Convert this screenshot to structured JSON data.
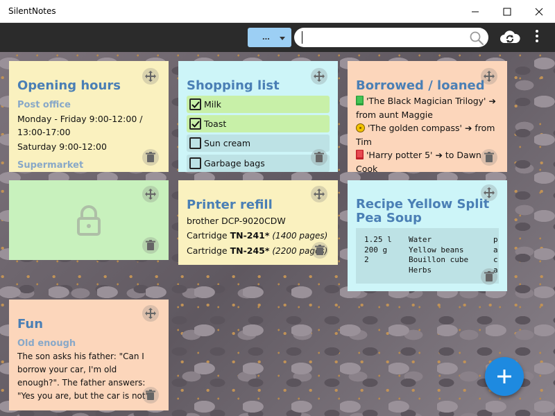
{
  "window": {
    "title": "SilentNotes"
  },
  "toolbar": {
    "filter_label": "...",
    "search_value": ""
  },
  "notes": {
    "opening_hours": {
      "title": "Opening hours",
      "sub1": "Post office",
      "line1": "Monday - Friday 9:00-12:00 / 13:00-17:00",
      "line2": "Saturday 9:00-12:00",
      "sub2": "Supermarket"
    },
    "shopping": {
      "title": "Shopping list",
      "items": [
        {
          "label": "Milk",
          "checked": true
        },
        {
          "label": "Toast",
          "checked": true
        },
        {
          "label": "Sun cream",
          "checked": false
        },
        {
          "label": "Garbage bags",
          "checked": false
        }
      ]
    },
    "borrowed": {
      "title": "Borrowed / loaned",
      "lines": [
        "'The Black Magician Trilogy' ➔ from aunt Maggie",
        "'The golden compass' ➔ from Tim",
        "'Harry potter 5' ➔ to Dawn Cook"
      ]
    },
    "printer": {
      "title": "Printer refill",
      "line1": "brother DCP-9020CDW",
      "cart1_prefix": "Cartridge ",
      "cart1_code": "TN-241*",
      "cart1_pages": "(1400 pages)",
      "cart2_prefix": "Cartridge ",
      "cart2_code": "TN-245*",
      "cart2_pages": "(2200 pages)"
    },
    "recipe": {
      "title": "Recipe Yellow Split Pea Soup",
      "rows": [
        {
          "qty": "1.25 l",
          "item": "Water",
          "note": "p"
        },
        {
          "qty": "200 g",
          "item": "Yellow beans",
          "note": "a"
        },
        {
          "qty": "2",
          "item": "Bouillon cube",
          "note": "c"
        },
        {
          "qty": "",
          "item": "Herbs",
          "note": "a"
        }
      ]
    },
    "fun": {
      "title": "Fun",
      "sub": "Old enough",
      "text": "The son asks his father: \"Can I borrow your car, I'm old enough?\". The father answers: \"Yes you are, but the car is not\"."
    }
  },
  "colors": {
    "yellow": "#faf1bf",
    "cyan": "#cdf5f8",
    "peach": "#fcd6bb",
    "green": "#c8f1bd",
    "title_blue": "#4a7fb5",
    "fab": "#1e8ae0"
  }
}
